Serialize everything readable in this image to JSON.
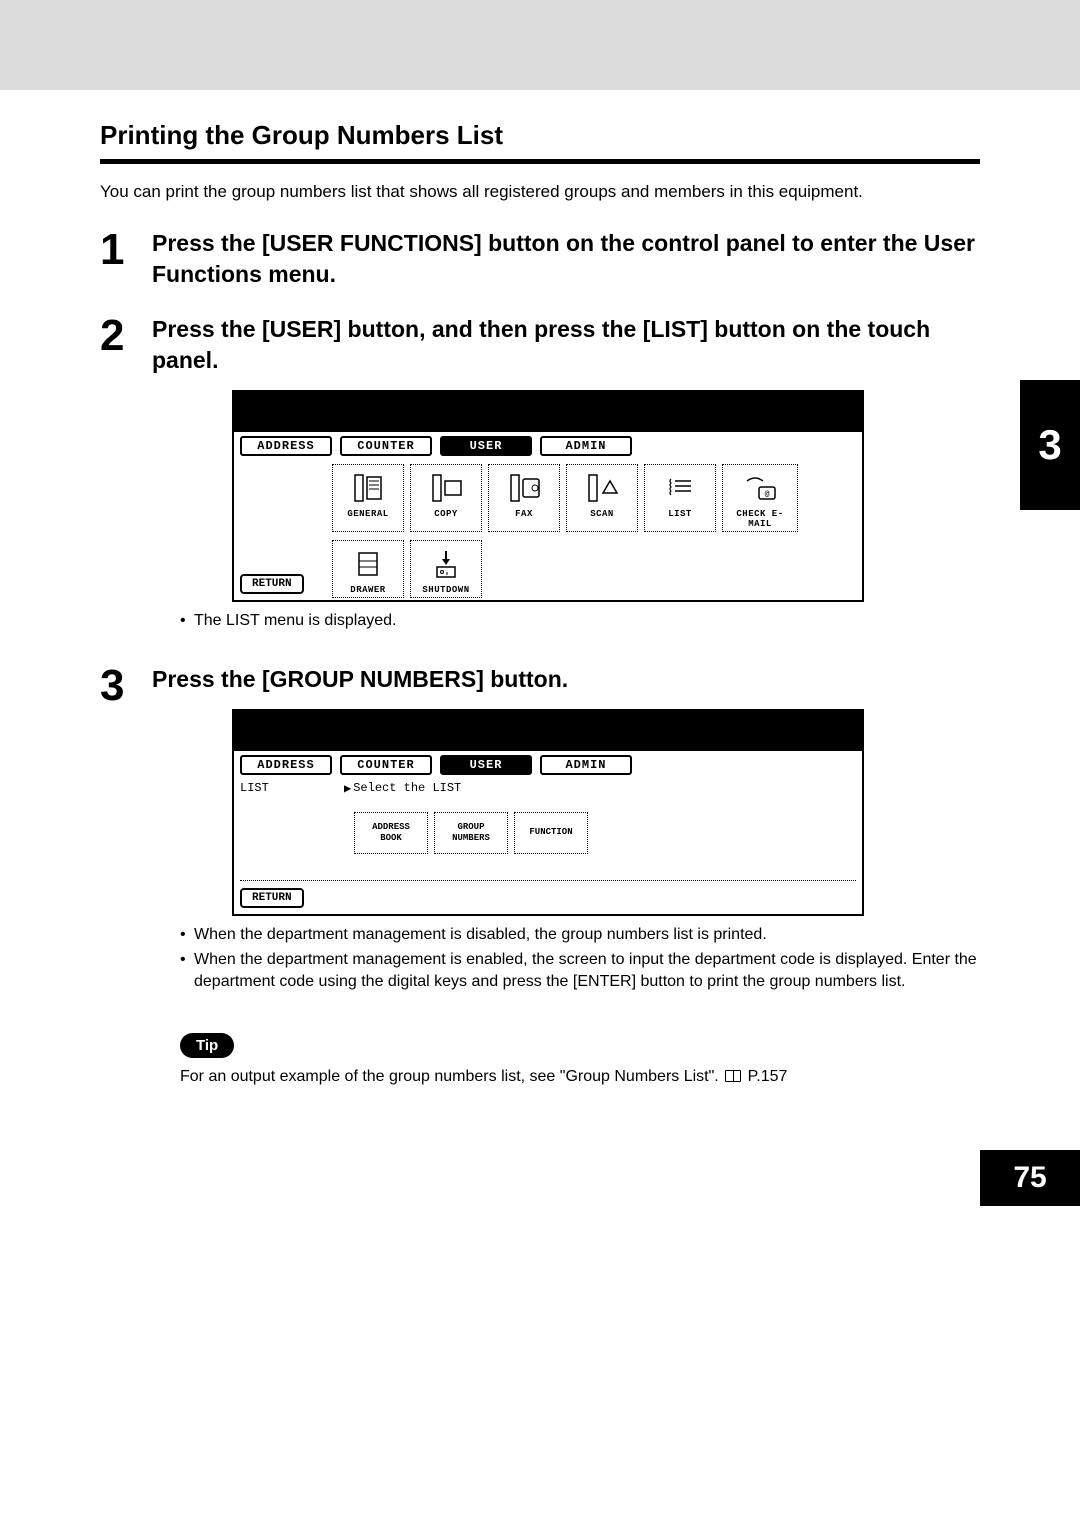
{
  "chapter_tab": "3",
  "page_number": "75",
  "section_title": "Printing the Group Numbers List",
  "intro": "You can print the group numbers list that shows all registered groups and members in this equipment.",
  "steps": {
    "s1": {
      "num": "1",
      "text": "Press the [USER FUNCTIONS] button on the control panel to enter the User Functions menu."
    },
    "s2": {
      "num": "2",
      "text": "Press the [USER] button, and then press the [LIST] button on the touch panel."
    },
    "s3": {
      "num": "3",
      "text": "Press the [GROUP NUMBERS] button."
    }
  },
  "screen1": {
    "tabs": {
      "address": "ADDRESS",
      "counter": "COUNTER",
      "user": "USER",
      "admin": "ADMIN"
    },
    "buttons": {
      "general": "GENERAL",
      "copy": "COPY",
      "fax": "FAX",
      "scan": "SCAN",
      "list": "LIST",
      "check_email": "CHECK E-MAIL",
      "drawer": "DRAWER",
      "shutdown": "SHUTDOWN"
    },
    "return": "RETURN"
  },
  "note_after_screen1": "The LIST menu is displayed.",
  "screen2": {
    "tabs": {
      "address": "ADDRESS",
      "counter": "COUNTER",
      "user": "USER",
      "admin": "ADMIN"
    },
    "side_label": "LIST",
    "prompt": "Select the LIST",
    "buttons": {
      "address_book_l1": "ADDRESS",
      "address_book_l2": "BOOK",
      "group_numbers_l1": "GROUP",
      "group_numbers_l2": "NUMBERS",
      "function": "FUNCTION"
    },
    "return": "RETURN"
  },
  "notes_after_screen2": {
    "n1": "When the department management is disabled, the group numbers list is printed.",
    "n2": "When the department management is enabled, the screen to input the department code is displayed.  Enter the department code using the digital keys and press the [ENTER] button to print the group numbers list."
  },
  "tip_label": "Tip",
  "tip_text_before": "For an output example of the group numbers list, see \"Group Numbers List\".  ",
  "tip_page_ref": " P.157"
}
